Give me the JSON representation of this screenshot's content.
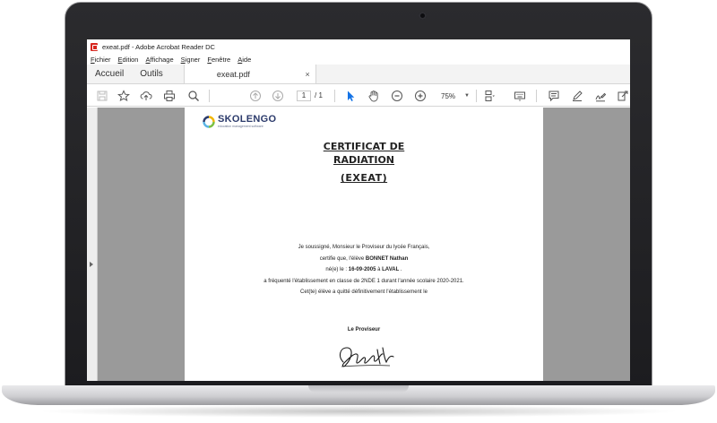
{
  "window": {
    "title": "exeat.pdf - Adobe Acrobat Reader DC"
  },
  "menubar": {
    "items": [
      "Fichier",
      "Edition",
      "Affichage",
      "Signer",
      "Fenêtre",
      "Aide"
    ]
  },
  "tabs": {
    "home": "Accueil",
    "tools": "Outils",
    "document": "exeat.pdf",
    "close": "×"
  },
  "toolbar": {
    "current_page": "1",
    "total_pages": "/ 1",
    "zoom": "75%",
    "icons": [
      "save-icon",
      "bookmark-star-icon",
      "upload-cloud-icon",
      "print-icon",
      "search-icon",
      "page-up-icon",
      "page-down-icon",
      "select-cursor-icon",
      "hand-icon",
      "zoom-out-icon",
      "zoom-in-icon",
      "page-layout-icon",
      "keyboard-icon",
      "comment-icon",
      "highlight-pen-icon",
      "sign-icon",
      "share-icon"
    ],
    "accent_color": "#1473e6"
  },
  "document": {
    "logo": {
      "name": "SKOLENGO",
      "tagline": "education management software",
      "colors": [
        "#2b3a6b",
        "#5ab4e5",
        "#f2b705",
        "#7bc043"
      ]
    },
    "title_line1": "CERTIFICAT DE",
    "title_line2": "RADIATION",
    "title_line3": "(EXEAT)",
    "line1": "Je soussigné, Monsieur le Proviseur du lycée Français,",
    "line2_prefix": "certifie que, l'élève",
    "student_name": "BONNET Nathan",
    "line3_prefix": "né(e) le :",
    "birth_date": "16-09-2005",
    "line3_mid": "à",
    "birth_place": "LAVAL",
    "line3_suffix": ".",
    "line4": "a fréquenté l'établissement en classe de 2NDE 1 durant l'année scolaire 2020-2021.",
    "line5": "Cet(te) élève a quitté définitivement l'établissement le",
    "signer": "Le Proviseur"
  }
}
